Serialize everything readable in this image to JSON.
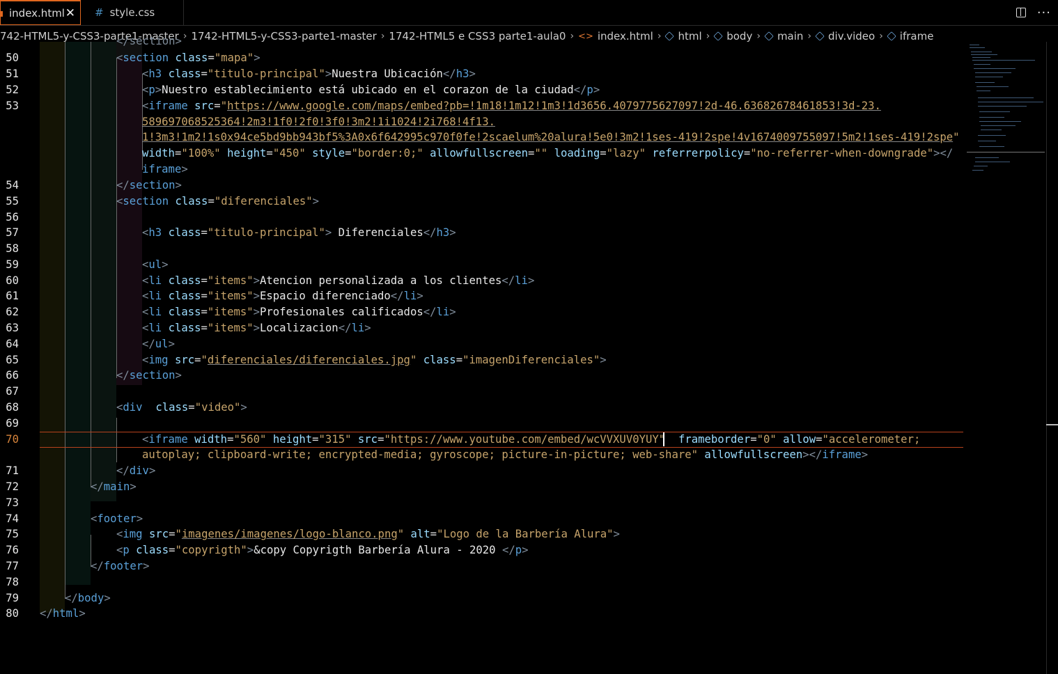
{
  "tabs": [
    {
      "label": "index.html",
      "active": true
    },
    {
      "label": "style.css",
      "active": false
    }
  ],
  "breadcrumb": [
    "742-HTML5-y-CSS3-parte1-master",
    "1742-HTML5-y-CSS3-parte1-master",
    "1742-HTML5 e CSS3 parte1-aula0",
    "index.html",
    "html",
    "body",
    "main",
    "div.video",
    "iframe"
  ],
  "editor": {
    "current_line": "70",
    "line_numbers": [
      "50",
      "51",
      "52",
      "53",
      "54",
      "55",
      "56",
      "57",
      "58",
      "59",
      "60",
      "61",
      "62",
      "63",
      "64",
      "65",
      "66",
      "67",
      "68",
      "69",
      "70",
      "71",
      "72",
      "73",
      "74",
      "75",
      "76",
      "77",
      "78",
      "79",
      "80"
    ],
    "partial_top": "</section>"
  },
  "colors": {
    "accent": "#e0671e",
    "tag": "#5aa0d8",
    "attr": "#9cdcfe",
    "value": "#c7a46b",
    "background": "#000000"
  }
}
